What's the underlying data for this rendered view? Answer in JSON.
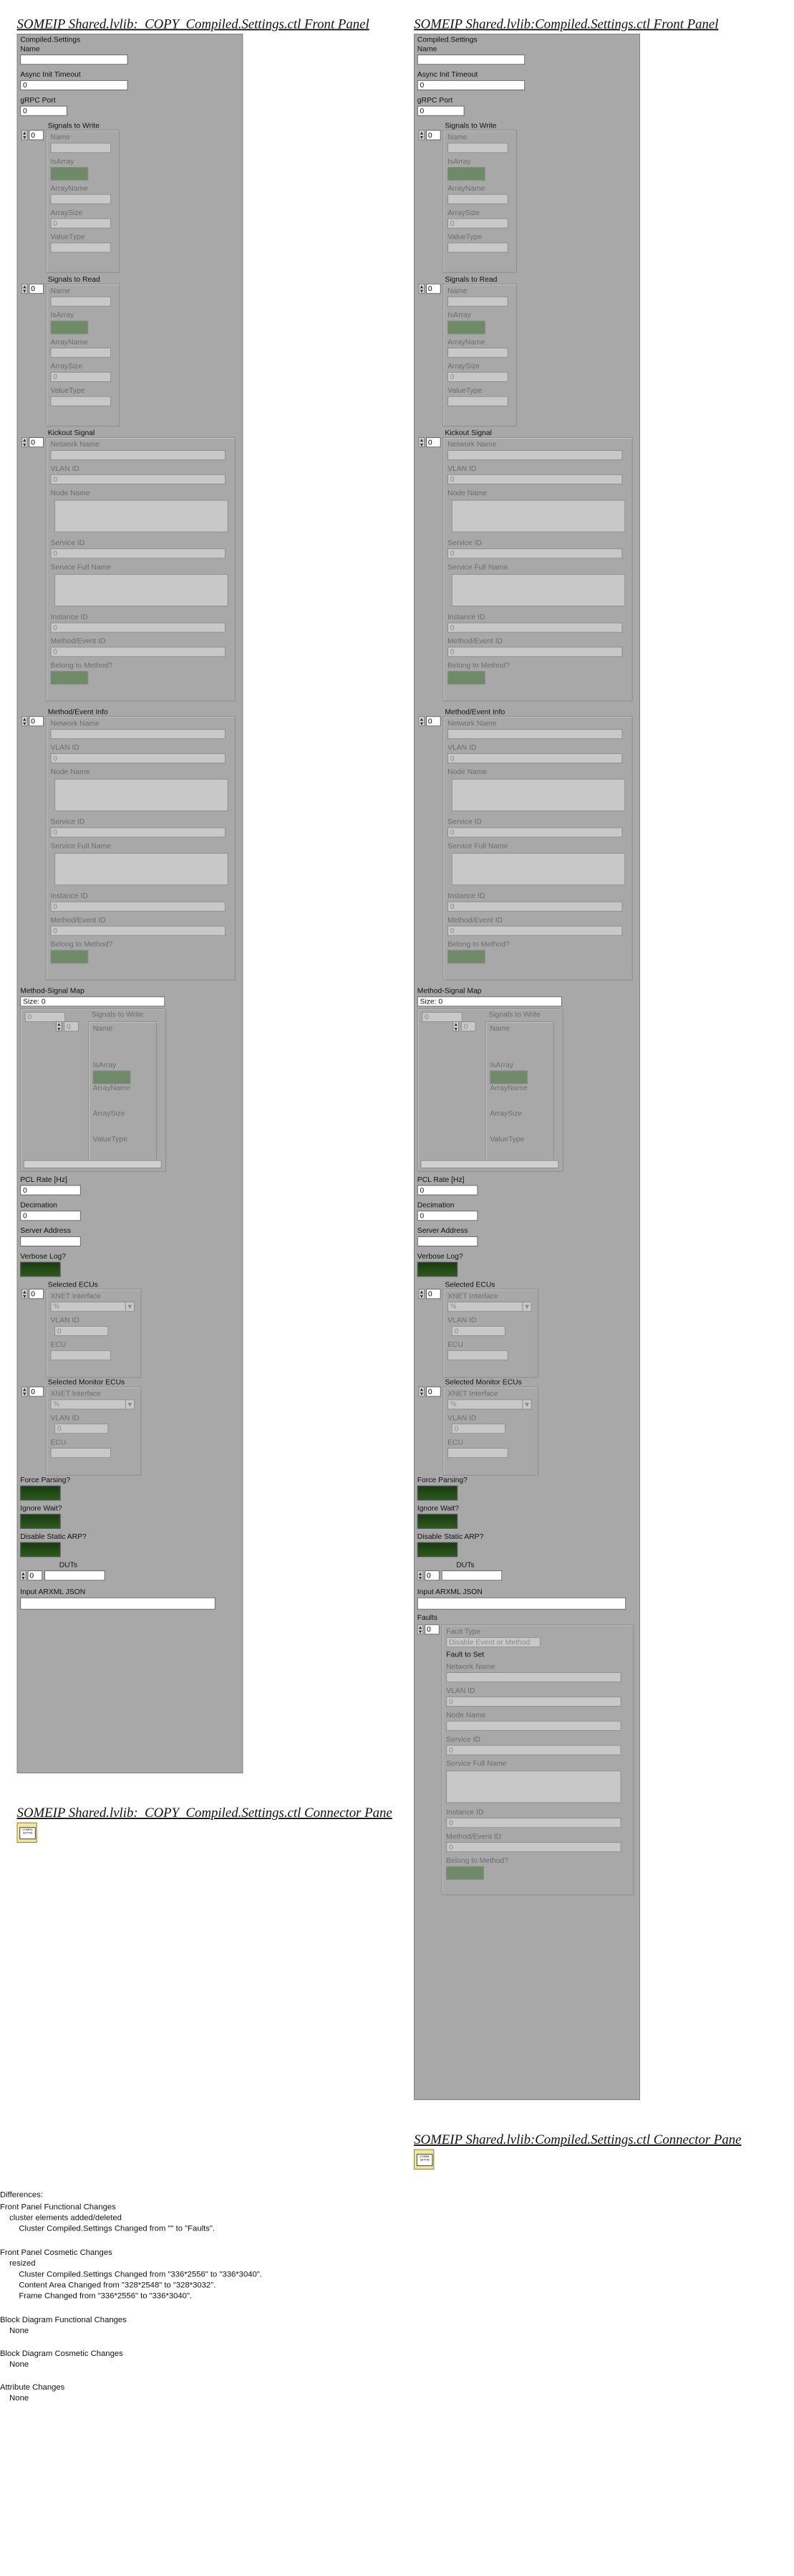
{
  "left": {
    "title": "SOMEIP Shared.lvlib:_COPY_Compiled.Settings.ctl Front Panel",
    "connector_title": "SOMEIP Shared.lvlib:_COPY_Compiled.Settings.ctl Connector Pane"
  },
  "right": {
    "title": "SOMEIP Shared.lvlib:Compiled.Settings.ctl Front Panel",
    "connector_title": "SOMEIP Shared.lvlib:Compiled.Settings.ctl Connector Pane"
  },
  "panel": {
    "cluster": "Compiled.Settings",
    "name": "Name",
    "async_timeout": "Async Init Timeout",
    "async_timeout_value": "0",
    "grpc_port": "gRPC Port",
    "grpc_port_value": "0",
    "signals_to_write": "Signals to Write",
    "signals_to_read": "Signals to Read",
    "index_value": "0",
    "sig": {
      "name": "Name",
      "isarray": "IsArray",
      "arrayname": "ArrayName",
      "arraysize": "ArraySize",
      "arraysize_value": "0",
      "valuetype": "ValueType"
    },
    "kickout_signal": "Kickout Signal",
    "method_event_info": "Method/Event Info",
    "ev": {
      "network_name": "Network Name",
      "vlan_id": "VLAN ID",
      "vlan_value": "0",
      "node_name": "Node Name",
      "service_id": "Service ID",
      "service_id_value": "0",
      "service_full_name": "Service Full Name",
      "instance_id": "Instance ID",
      "instance_value": "0",
      "method_event_id": "Method/Event ID",
      "method_event_value": "0",
      "belong": "Belong to Method?"
    },
    "method_signal_map": "Method-Signal Map",
    "size": "Size: 0",
    "map_index": "0",
    "pcl_rate": "PCL Rate [Hz]",
    "pcl_value": "0",
    "decimation": "Decimation",
    "decimation_value": "0",
    "server_address": "Server Address",
    "verbose": "Verbose Log?",
    "selected_ecus": "Selected ECUs",
    "selected_monitor_ecus": "Selected Monitor ECUs",
    "ecu": {
      "xnet": "XNET Interface",
      "xnet_value": "%",
      "vlan_id": "VLAN ID",
      "vlan_value": "0",
      "ecu": "ECU"
    },
    "force_parsing": "Force Parsing?",
    "ignore_wait": "Ignore Wait?",
    "disable_arp": "Disable Static ARP?",
    "duts": "DUTs",
    "input_arxml": "Input ARXML JSON",
    "faults": "Faults",
    "fault_type": "Fault Type",
    "fault_type_value": "Disable Event or Method",
    "fault_to_set": "Fault to Set",
    "icon_text": "COMPIL SETTIN"
  },
  "differences": {
    "heading": "Differences:",
    "fp_func": "Front Panel Functional Changes",
    "fp_func_1": "cluster elements added/deleted",
    "fp_func_2": "Cluster Compiled.Settings Changed from \"\" to \"Faults\".",
    "fp_cos": "Front Panel Cosmetic Changes",
    "fp_cos_1": "resized",
    "fp_cos_2": "Cluster Compiled.Settings Changed from \"336*2556\" to \"336*3040\".",
    "fp_cos_3": "Content Area  Changed from \"328*2548\" to \"328*3032\".",
    "fp_cos_4": "Frame  Changed from \"336*2556\" to \"336*3040\".",
    "bd_func": "Block Diagram Functional Changes",
    "bd_func_1": "None",
    "bd_cos": "Block Diagram Cosmetic Changes",
    "bd_cos_1": "None",
    "attr": "Attribute Changes",
    "attr_1": "None"
  }
}
